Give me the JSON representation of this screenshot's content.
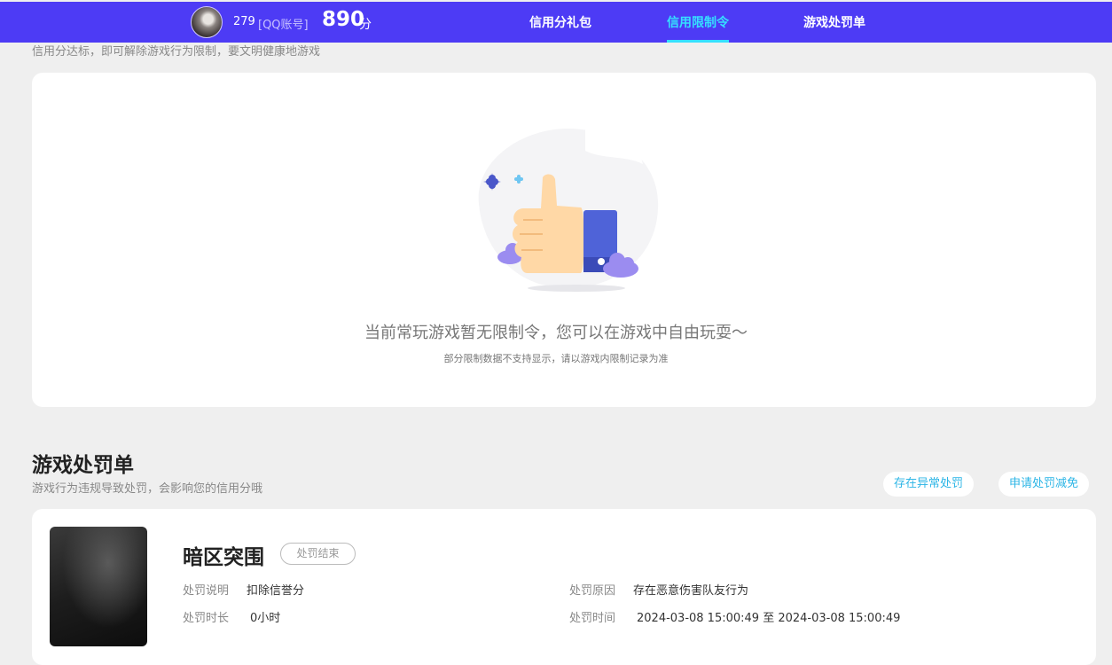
{
  "header": {
    "qq_number": "279",
    "qq_label": "[QQ账号]",
    "score": "890",
    "score_unit": "分",
    "tabs": [
      {
        "label": "信用分礼包"
      },
      {
        "label": "信用限制令"
      },
      {
        "label": "游戏处罚单"
      }
    ],
    "active_tab": "信用限制令",
    "accent_color": "#4d3bf5",
    "active_color": "#35e0ff"
  },
  "restriction": {
    "subtitle": "信用分达标，即可解除游戏行为限制，要文明健康地游戏",
    "empty_title": "当前常玩游戏暂无限制令，您可以在游戏中自由玩耍～",
    "empty_note": "部分限制数据不支持显示，请以游戏内限制记录为准",
    "illustration_icon": "thumbs-up-icon"
  },
  "penalty": {
    "title": "游戏处罚单",
    "subtitle": "游戏行为违规导致处罚，会影响您的信用分哦",
    "btn_abnormal": "存在异常处罚",
    "btn_appeal": "申请处罚减免",
    "item": {
      "game_name": "暗区突围",
      "status": "处罚结束",
      "desc_label": "处罚说明",
      "desc_value": "扣除信誉分",
      "duration_label": "处罚时长",
      "duration_value": "0小时",
      "reason_label": "处罚原因",
      "reason_value": "存在恶意伤害队友行为",
      "time_label": "处罚时间",
      "time_value": "2024-03-08 15:00:49 至 2024-03-08 15:00:49"
    }
  }
}
